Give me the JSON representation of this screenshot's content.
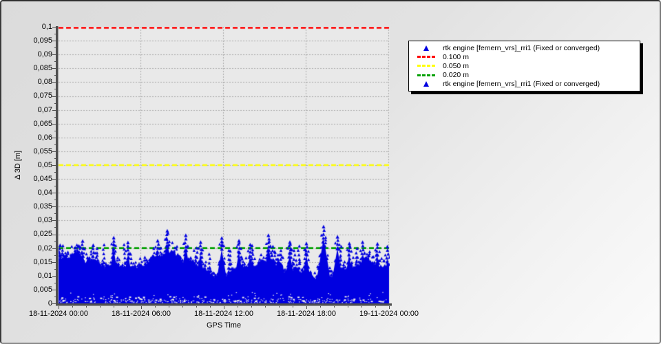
{
  "window": {
    "bg_gradient_start": "#dbdbdb",
    "bg_gradient_end": "#fbfbfb",
    "border_dark": "#2f2f2f",
    "border_light": "#8a8a8a"
  },
  "chart_data": {
    "type": "scatter",
    "title": "",
    "xlabel": "GPS Time",
    "ylabel": "Δ 3D [m]",
    "ylim": [
      0,
      0.1
    ],
    "y_major_step": 0.005,
    "y_minor_step": 0.0025,
    "y_tick_labels": [
      "0,1",
      "0,095",
      "0,09",
      "0,085",
      "0,08",
      "0,075",
      "0,07",
      "0,065",
      "0,06",
      "0,055",
      "0,05",
      "0,045",
      "0,04",
      "0,035",
      "0,03",
      "0,025",
      "0,02",
      "0,015",
      "0,01",
      "0,005",
      "0"
    ],
    "x_tick_labels": [
      "18-11-2024 00:00",
      "18-11-2024 06:00",
      "18-11-2024 12:00",
      "18-11-2024 18:00",
      "19-11-2024 00:00"
    ],
    "x_minor_ticks_per_major": 6,
    "grid": {
      "style": "dashed",
      "color": "#a9a9a9"
    },
    "plot_bg": "#e9e9e9",
    "axis_color": "#4f4f4f",
    "thresholds": [
      {
        "label": "0.100 m",
        "value": 0.1,
        "color": "#ff0000"
      },
      {
        "label": "0.050 m",
        "value": 0.05,
        "color": "#ffff00"
      },
      {
        "label": "0.020 m",
        "value": 0.02,
        "color": "#00a000"
      }
    ],
    "series": [
      {
        "name": "rtk engine [femern_vrs]_rri1 (Fixed or converged)",
        "marker": "triangle",
        "color": "#0000e0",
        "band_min": 0.0,
        "band_typical_top": 0.016,
        "band_jitter": 0.004,
        "max_value": 0.0278,
        "seed": 987,
        "spikes": [
          {
            "x": 0.005,
            "v": 0.021
          },
          {
            "x": 0.073,
            "v": 0.0225
          },
          {
            "x": 0.105,
            "v": 0.021
          },
          {
            "x": 0.167,
            "v": 0.0237
          },
          {
            "x": 0.21,
            "v": 0.022
          },
          {
            "x": 0.3,
            "v": 0.0226
          },
          {
            "x": 0.329,
            "v": 0.0262
          },
          {
            "x": 0.385,
            "v": 0.0246
          },
          {
            "x": 0.43,
            "v": 0.0221
          },
          {
            "x": 0.494,
            "v": 0.0236
          },
          {
            "x": 0.546,
            "v": 0.0226
          },
          {
            "x": 0.58,
            "v": 0.0212
          },
          {
            "x": 0.635,
            "v": 0.0246
          },
          {
            "x": 0.7,
            "v": 0.0221
          },
          {
            "x": 0.75,
            "v": 0.0216
          },
          {
            "x": 0.802,
            "v": 0.0277
          },
          {
            "x": 0.844,
            "v": 0.024
          },
          {
            "x": 0.88,
            "v": 0.0216
          },
          {
            "x": 0.92,
            "v": 0.0221
          },
          {
            "x": 0.965,
            "v": 0.0215
          },
          {
            "x": 0.995,
            "v": 0.0205
          }
        ]
      }
    ]
  },
  "legend": {
    "items": [
      {
        "marker": "triangle",
        "color": "#0000e0",
        "label": "rtk engine [femern_vrs]_rri1 (Fixed or converged)"
      },
      {
        "marker": "dashes",
        "color": "#ff0000",
        "label": "0.100 m"
      },
      {
        "marker": "dashes",
        "color": "#ffff00",
        "label": "0.050 m"
      },
      {
        "marker": "dashes",
        "color": "#00a000",
        "label": "0.020 m"
      },
      {
        "marker": "triangle",
        "color": "#0000e0",
        "label": "rtk engine [femern_vrs]_rri1 (Fixed or converged)"
      }
    ]
  }
}
